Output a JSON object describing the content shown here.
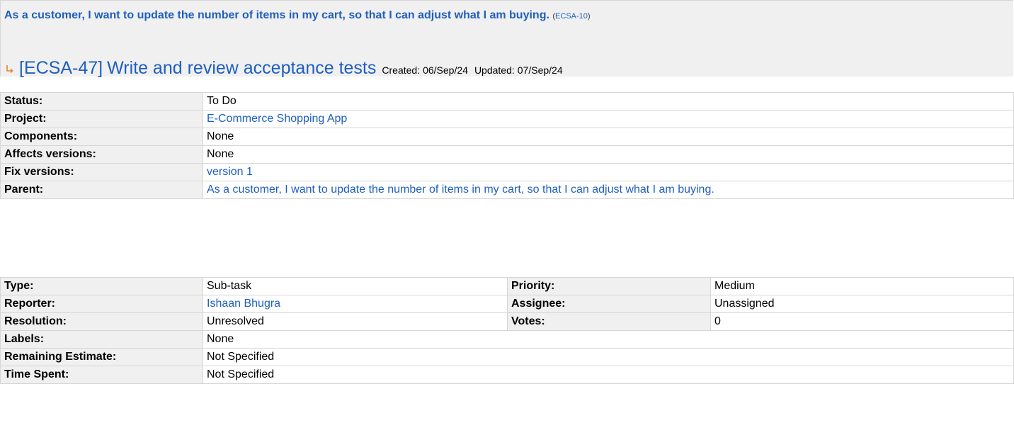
{
  "parent": {
    "summary": "As a customer, I want to update the number of items in my cart, so that I can adjust what I am buying.",
    "key": "ECSA-10"
  },
  "issue": {
    "key": "[ECSA-47]",
    "summary": "Write and review acceptance tests",
    "created_label": "Created:",
    "created": "06/Sep/24",
    "updated_label": "Updated:",
    "updated": "07/Sep/24",
    "icon": "subtask-icon"
  },
  "fields": {
    "status": {
      "label": "Status:",
      "value": "To Do"
    },
    "project": {
      "label": "Project:",
      "value": "E-Commerce Shopping App"
    },
    "components": {
      "label": "Components:",
      "value": "None"
    },
    "affects_versions": {
      "label": "Affects versions:",
      "value": "None"
    },
    "fix_versions": {
      "label": "Fix versions:",
      "value": "version 1"
    },
    "parent": {
      "label": "Parent:",
      "value": "As a customer, I want to update the number of items in my cart, so that I can adjust what I am buying."
    }
  },
  "details": {
    "type": {
      "label": "Type:",
      "value": "Sub-task"
    },
    "priority": {
      "label": "Priority:",
      "value": "Medium"
    },
    "reporter": {
      "label": "Reporter:",
      "value": "Ishaan Bhugra"
    },
    "assignee": {
      "label": "Assignee:",
      "value": "Unassigned"
    },
    "resolution": {
      "label": "Resolution:",
      "value": "Unresolved"
    },
    "votes": {
      "label": "Votes:",
      "value": "0"
    },
    "labels": {
      "label": "Labels:",
      "value": "None"
    },
    "remaining_estimate": {
      "label": "Remaining Estimate:",
      "value": "Not Specified"
    },
    "time_spent": {
      "label": "Time Spent:",
      "value": "Not Specified"
    }
  },
  "colors": {
    "link": "#1f5fbf",
    "label_bg": "#f0f0f0",
    "border": "#d6d6d6"
  }
}
